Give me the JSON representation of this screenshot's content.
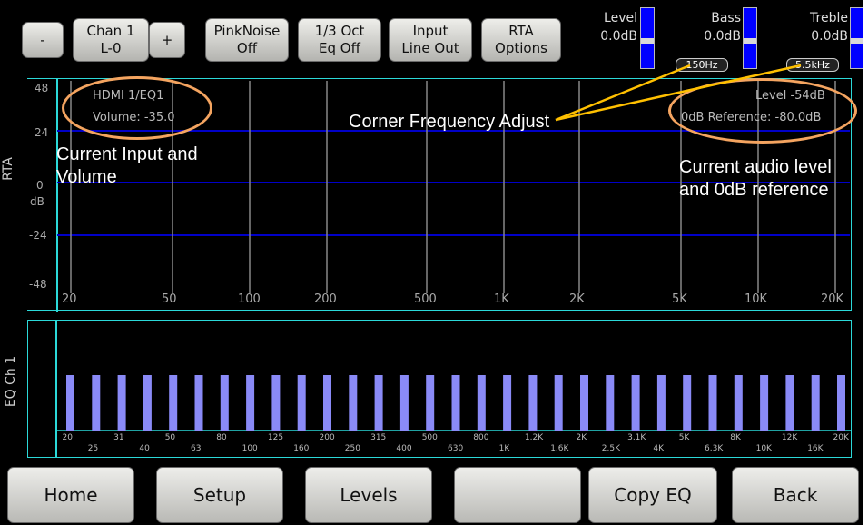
{
  "toolbar": {
    "minus": "-",
    "chan_line1": "Chan 1",
    "chan_line2": "L-0",
    "plus": "+",
    "pinknoise_line1": "PinkNoise",
    "pinknoise_line2": "Off",
    "oct_line1": "1/3 Oct",
    "oct_line2": "Eq Off",
    "input_line1": "Input",
    "input_line2": "Line Out",
    "rta_line1": "RTA",
    "rta_line2": "Options"
  },
  "meters": {
    "level_label": "Level",
    "level_value": "0.0dB",
    "bass_label": "Bass",
    "bass_value": "0.0dB",
    "bass_freq": "150Hz",
    "treble_label": "Treble",
    "treble_value": "0.0dB",
    "treble_freq": "5.5kHz",
    "accent": "#0000ff"
  },
  "rta": {
    "side_label": "RTA",
    "y_ticks": [
      "48",
      "24",
      "0",
      "-24",
      "-48"
    ],
    "y_unit": "dB",
    "x_ticks": [
      "20",
      "50",
      "100",
      "200",
      "500",
      "1K",
      "2K",
      "5K",
      "10K",
      "20K"
    ],
    "input_name": "HDMI 1/EQ1",
    "volume": "Volume: -35.0",
    "level": "Level -54dB",
    "reference": "0dB Reference: -80.0dB",
    "grid_color": "#2bd9d9"
  },
  "eq": {
    "side_label": "EQ Ch 1",
    "bar_color": "#8a8af7",
    "freq_top": [
      "20",
      "31",
      "50",
      "80",
      "125",
      "200",
      "315",
      "500",
      "800",
      "1.2K",
      "2K",
      "3.1K",
      "5K",
      "8K",
      "12K",
      "20K"
    ],
    "freq_bottom": [
      "25",
      "40",
      "63",
      "100",
      "160",
      "250",
      "400",
      "630",
      "1K",
      "1.6K",
      "2.5K",
      "4K",
      "6.3K",
      "10K",
      "16K"
    ]
  },
  "bottom": {
    "home": "Home",
    "setup": "Setup",
    "levels": "Levels",
    "blank": "",
    "copy_eq": "Copy EQ",
    "back": "Back"
  },
  "callouts": {
    "input_volume": "Current Input and Volume",
    "corner_freq": "Corner Frequency Adjust",
    "audio_level": "Current audio level and 0dB reference",
    "oval_color": "#f4a460",
    "line_color": "#ffc000"
  }
}
